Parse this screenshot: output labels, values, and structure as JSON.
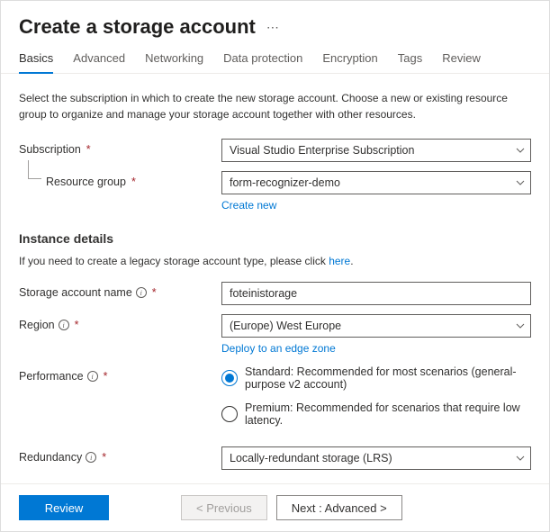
{
  "header": {
    "title": "Create a storage account"
  },
  "tabs": [
    {
      "label": "Basics",
      "active": true
    },
    {
      "label": "Advanced"
    },
    {
      "label": "Networking"
    },
    {
      "label": "Data protection"
    },
    {
      "label": "Encryption"
    },
    {
      "label": "Tags"
    },
    {
      "label": "Review"
    }
  ],
  "intro": "Select the subscription in which to create the new storage account. Choose a new or existing resource group to organize and manage your storage account together with other resources.",
  "fields": {
    "subscription": {
      "label": "Subscription",
      "value": "Visual Studio Enterprise Subscription"
    },
    "resource_group": {
      "label": "Resource group",
      "value": "form-recognizer-demo",
      "create_new": "Create new"
    }
  },
  "instance": {
    "title": "Instance details",
    "note_prefix": "If you need to create a legacy storage account type, please click ",
    "note_link": "here",
    "note_suffix": "."
  },
  "storage_name": {
    "label": "Storage account name",
    "value": "foteinistorage"
  },
  "region": {
    "label": "Region",
    "value": "(Europe) West Europe",
    "deploy_link": "Deploy to an edge zone"
  },
  "performance": {
    "label": "Performance",
    "standard": "Standard",
    "standard_desc": ": Recommended for most scenarios (general-purpose v2 account)",
    "premium": "Premium",
    "premium_desc": ": Recommended for scenarios that require low latency."
  },
  "redundancy": {
    "label": "Redundancy",
    "value": "Locally-redundant storage (LRS)"
  },
  "footer": {
    "review": "Review",
    "previous": "< Previous",
    "next": "Next : Advanced >"
  }
}
